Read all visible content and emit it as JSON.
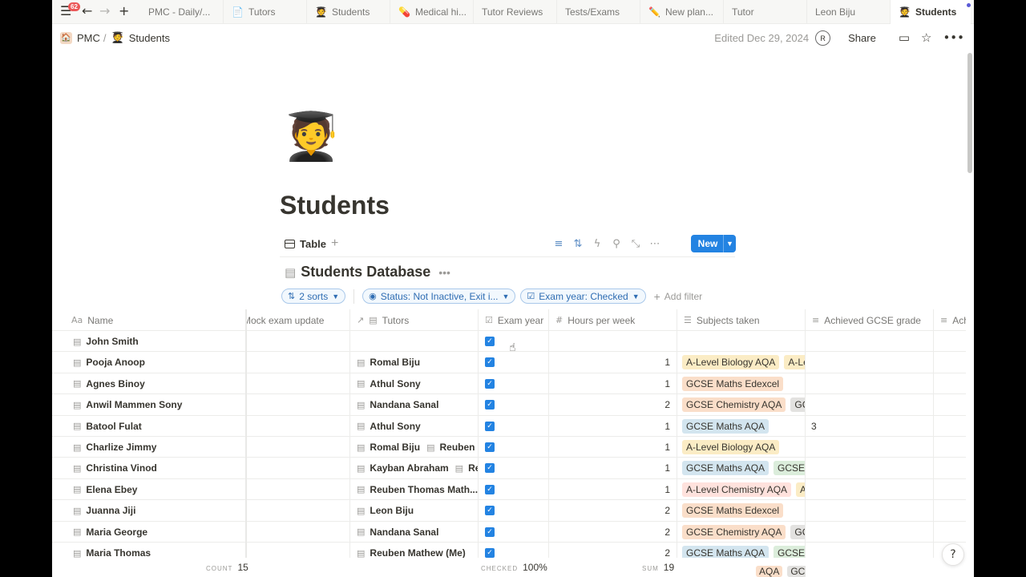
{
  "tabbar": {
    "badge": "62",
    "tabs": [
      {
        "icon": "",
        "label": "PMC - Daily/...",
        "width": 104
      },
      {
        "icon": "📄",
        "label": "Tutors",
        "width": 104
      },
      {
        "icon": "🧑‍🎓",
        "label": "Students",
        "width": 104
      },
      {
        "icon": "💊",
        "label": "Medical hi...",
        "width": 104
      },
      {
        "icon": "",
        "label": "Tutor Reviews",
        "width": 104
      },
      {
        "icon": "",
        "label": "Tests/Exams",
        "width": 104
      },
      {
        "icon": "✏️",
        "label": "New plan...",
        "width": 104
      },
      {
        "icon": "",
        "label": "Tutor",
        "width": 104
      },
      {
        "icon": "",
        "label": "Leon Biju",
        "width": 104
      },
      {
        "icon": "🧑‍🎓",
        "label": "Students",
        "width": 100
      }
    ]
  },
  "breadcrumb": {
    "parent": "PMC",
    "sep": "/",
    "current": "Students",
    "current_icon": "🧑‍🎓"
  },
  "topbar": {
    "edited": "Edited Dec 29, 2024",
    "avatar": "R",
    "share": "Share"
  },
  "page": {
    "emoji": "🧑‍🎓",
    "title": "Students"
  },
  "view": {
    "tab_label": "Table",
    "new_label": "New"
  },
  "database": {
    "title": "Students Database"
  },
  "filters": {
    "sorts": "2 sorts",
    "status": "Status: Not Inactive, Exit i...",
    "exam_year": "Exam year: Checked",
    "add_filter": "Add filter"
  },
  "columns": {
    "name": "Name",
    "name_icon": "Aa",
    "mock": "Mock exam update",
    "tutors": "Tutors",
    "exam": "Exam year",
    "hours": "Hours per week",
    "subjects": "Subjects taken",
    "grade": "Achieved GCSE grade",
    "extra": "Ach"
  },
  "colors": {
    "accent": "#2383e2",
    "tag_yellow": "#fbecc5",
    "tag_orange": "#fadec9",
    "tag_blue": "#d3e5ef",
    "tag_green": "#dbeddb",
    "tag_red": "#ffe2dd",
    "tag_grey": "#e3e2e0"
  },
  "rows": [
    {
      "name": "John Smith",
      "tutors": [],
      "hours": "",
      "subjects": [],
      "grade": ""
    },
    {
      "name": "Pooja Anoop",
      "tutors": [
        "Romal Biju"
      ],
      "hours": "1",
      "subjects": [
        {
          "t": "A-Level Biology AQA",
          "c": "tag_yellow"
        },
        {
          "t": "A-Level",
          "c": "tag_yellow"
        }
      ],
      "grade": ""
    },
    {
      "name": "Agnes Binoy",
      "tutors": [
        "Athul Sony"
      ],
      "hours": "1",
      "subjects": [
        {
          "t": "GCSE Maths Edexcel",
          "c": "tag_orange"
        }
      ],
      "grade": ""
    },
    {
      "name": "Anwil Mammen Sony",
      "tutors": [
        "Nandana Sanal"
      ],
      "hours": "2",
      "subjects": [
        {
          "t": "GCSE Chemistry AQA",
          "c": "tag_orange"
        },
        {
          "t": "GCSE",
          "c": "tag_grey"
        }
      ],
      "grade": ""
    },
    {
      "name": "Batool Fulat",
      "tutors": [
        "Athul Sony"
      ],
      "hours": "1",
      "subjects": [
        {
          "t": "GCSE Maths AQA",
          "c": "tag_blue"
        }
      ],
      "grade": "3"
    },
    {
      "name": "Charlize Jimmy",
      "tutors": [
        "Romal Biju",
        "Reuben Th"
      ],
      "hours": "1",
      "subjects": [
        {
          "t": "A-Level Biology AQA",
          "c": "tag_yellow"
        }
      ],
      "grade": ""
    },
    {
      "name": "Christina Vinod",
      "tutors": [
        "Kayban Abraham",
        "Reu"
      ],
      "hours": "1",
      "subjects": [
        {
          "t": "GCSE Maths AQA",
          "c": "tag_blue"
        },
        {
          "t": "GCSE Ph",
          "c": "tag_green"
        }
      ],
      "grade": ""
    },
    {
      "name": "Elena Ebey",
      "tutors": [
        "Reuben Thomas Math..."
      ],
      "hours": "1",
      "subjects": [
        {
          "t": "A-Level Chemistry AQA",
          "c": "tag_red"
        },
        {
          "t": "A-",
          "c": "tag_yellow"
        }
      ],
      "grade": ""
    },
    {
      "name": "Juanna Jiji",
      "tutors": [
        "Leon Biju"
      ],
      "hours": "2",
      "subjects": [
        {
          "t": "GCSE Maths Edexcel",
          "c": "tag_orange"
        }
      ],
      "grade": ""
    },
    {
      "name": "Maria George",
      "tutors": [
        "Nandana Sanal"
      ],
      "hours": "2",
      "subjects": [
        {
          "t": "GCSE Chemistry AQA",
          "c": "tag_orange"
        },
        {
          "t": "GCS",
          "c": "tag_grey"
        }
      ],
      "grade": ""
    },
    {
      "name": "Maria Thomas",
      "tutors": [
        "Reuben Mathew (Me)"
      ],
      "hours": "2",
      "subjects": [
        {
          "t": "GCSE Maths AQA",
          "c": "tag_blue"
        },
        {
          "t": "GCSE Ph",
          "c": "tag_green"
        }
      ],
      "grade": ""
    }
  ],
  "footer": {
    "count_label": "COUNT",
    "count": "15",
    "checked_label": "CHECKED",
    "checked": "100%",
    "sum_label": "SUM",
    "sum": "19",
    "overflow_tags": [
      {
        "t": "AQA",
        "c": "tag_orange"
      },
      {
        "t": "GCS",
        "c": "tag_grey"
      }
    ]
  }
}
